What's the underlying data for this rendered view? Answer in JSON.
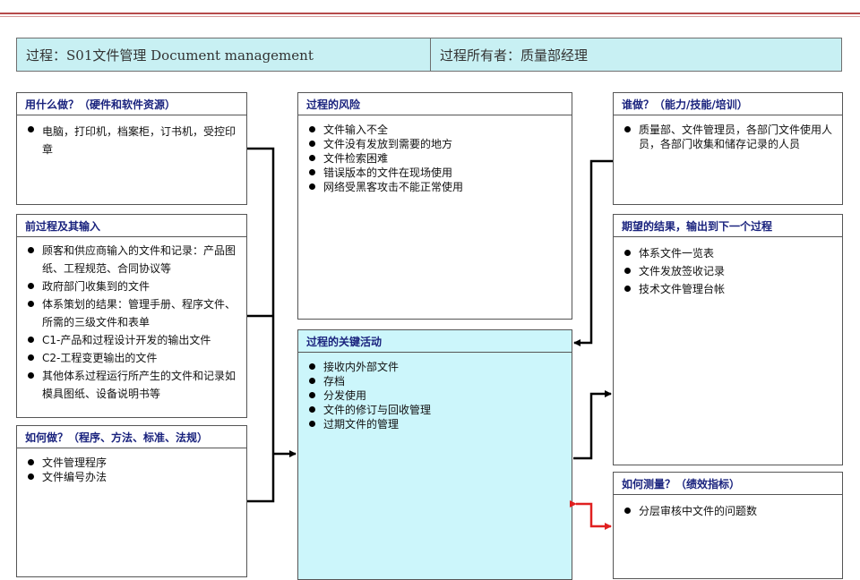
{
  "header": {
    "process_label": "过程：S01文件管理 Document management",
    "owner_label": "过程所有者：质量部经理"
  },
  "boxes": {
    "resources": {
      "title": "用什么做？（硬件和软件资源）",
      "items": [
        "电脑，打印机，档案柜，订书机，受控印章"
      ]
    },
    "inputs": {
      "title": "前过程及其输入",
      "items": [
        "顾客和供应商输入的文件和记录：产品图纸、工程规范、合同协议等",
        "政府部门收集到的文件",
        "体系策划的结果：管理手册、程序文件、所需的三级文件和表单",
        "C1-产品和过程设计开发的输出文件",
        "C2-工程变更输出的文件",
        "其他体系过程运行所产生的文件和记录如模具图纸、设备说明书等"
      ]
    },
    "methods": {
      "title": "如何做？（程序、方法、标准、法规）",
      "items": [
        "文件管理程序",
        "文件编号办法"
      ]
    },
    "risks": {
      "title": "过程的风险",
      "items": [
        "文件输入不全",
        "文件没有发放到需要的地方",
        "文件检索困难",
        "错误版本的文件在现场使用",
        "网络受黑客攻击不能正常使用"
      ]
    },
    "activities": {
      "title": "过程的关键活动",
      "items": [
        "接收内外部文件",
        "存档",
        "分发使用",
        "文件的修订与回收管理",
        "过期文件的管理"
      ]
    },
    "who": {
      "title": "谁做？（能力/技能/培训）",
      "items": [
        "质量部、文件管理员，各部门文件使用人员，各部门收集和储存记录的人员"
      ]
    },
    "outputs": {
      "title": "期望的结果，输出到下一个过程",
      "items": [
        "体系文件一览表",
        "文件发放签收记录",
        "技术文件管理台帐"
      ]
    },
    "measures": {
      "title": "如何测量？（绩效指标）",
      "items": [
        "分层审核中文件的问题数"
      ]
    }
  },
  "colors": {
    "title_text": "#1a237e",
    "header_bg": "#c8f0f3",
    "activity_bg": "#ccf6fb",
    "connector": "#000000",
    "measure_connector": "#e02020"
  }
}
